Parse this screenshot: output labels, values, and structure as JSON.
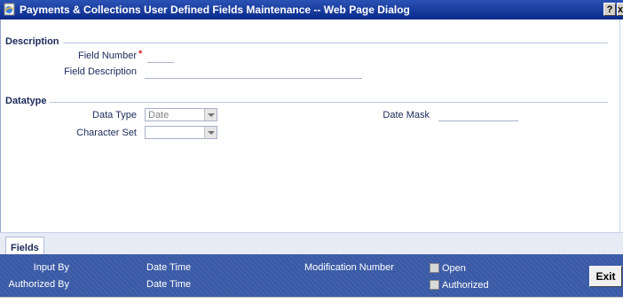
{
  "window": {
    "title": "Payments & Collections User Defined Fields Maintenance -- Web Page Dialog",
    "help_label": "?",
    "close_label": "x"
  },
  "description": {
    "section_label": "Description",
    "field_number_label": "Field Number",
    "required_marker": "*",
    "field_number_value": "",
    "field_description_label": "Field Description",
    "field_description_value": ""
  },
  "datatype": {
    "section_label": "Datatype",
    "data_type_label": "Data Type",
    "data_type_value": "Date",
    "character_set_label": "Character Set",
    "character_set_value": "",
    "date_mask_label": "Date Mask",
    "date_mask_value": ""
  },
  "tabs": [
    {
      "label": "Fields"
    }
  ],
  "footer": {
    "input_by_label": "Input By",
    "input_date_time_label": "Date Time",
    "authorized_by_label": "Authorized By",
    "authorized_date_time_label": "Date Time",
    "modification_number_label": "Modification Number",
    "open_label": "Open",
    "authorized_label": "Authorized",
    "exit_label": "Exit"
  },
  "colors": {
    "titlebar": "#0a2a8a",
    "footer": "#3a5aa6",
    "required": "#e02020"
  }
}
